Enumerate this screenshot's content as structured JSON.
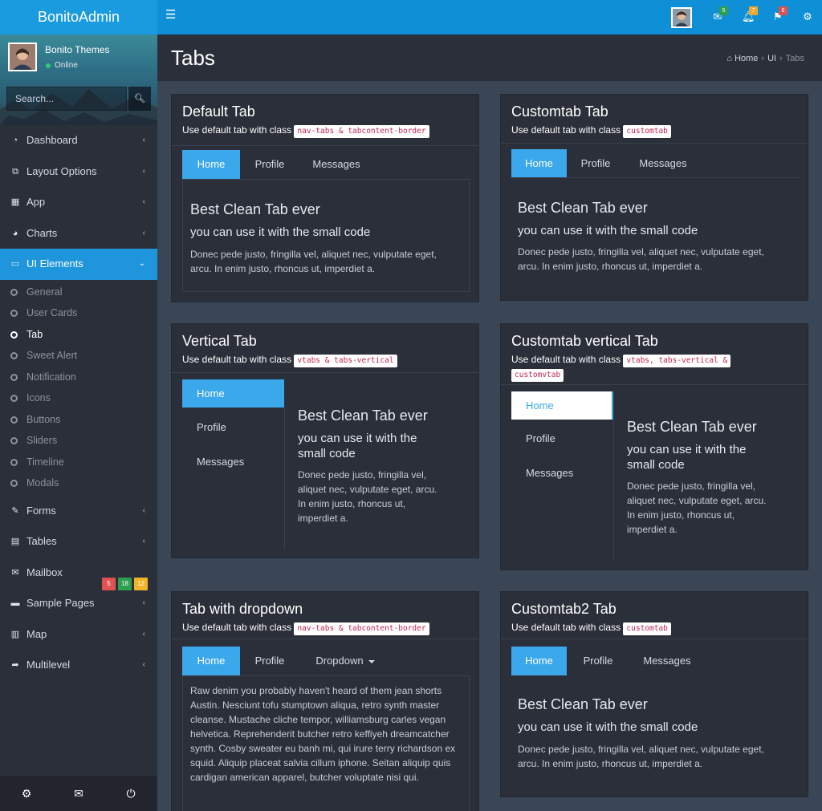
{
  "app": {
    "brand": "BonitoAdmin"
  },
  "topbar": {
    "badges": [
      {
        "icon": "envelope-icon",
        "count": "5",
        "color": "#2e9e4f"
      },
      {
        "icon": "bell-icon",
        "count": "7",
        "color": "#f0a92e"
      },
      {
        "icon": "flag-icon",
        "count": "6",
        "color": "#e05252"
      }
    ]
  },
  "user": {
    "name": "Bonito Themes",
    "status": "Online"
  },
  "search": {
    "placeholder": "Search..."
  },
  "nav": [
    {
      "label": "Dashboard",
      "icon": "dashboard-icon"
    },
    {
      "label": "Layout Options",
      "icon": "copy-icon"
    },
    {
      "label": "App",
      "icon": "grid-icon"
    },
    {
      "label": "Charts",
      "icon": "pie-chart-icon"
    },
    {
      "label": "UI Elements",
      "icon": "laptop-icon"
    },
    {
      "label": "Forms",
      "icon": "edit-icon"
    },
    {
      "label": "Tables",
      "icon": "table-icon"
    },
    {
      "label": "Mailbox",
      "icon": "envelope-icon"
    },
    {
      "label": "Sample Pages",
      "icon": "folder-icon"
    },
    {
      "label": "Map",
      "icon": "map-icon"
    },
    {
      "label": "Multilevel",
      "icon": "share-icon"
    }
  ],
  "sub_nav": [
    "General",
    "User Cards",
    "Tab",
    "Sweet Alert",
    "Notification",
    "Icons",
    "Buttons",
    "Sliders",
    "Timeline",
    "Modals"
  ],
  "mail_badges": [
    {
      "count": "5",
      "color": "#e05252"
    },
    {
      "count": "18",
      "color": "#2e9e4f"
    },
    {
      "count": "12",
      "color": "#f0b429"
    }
  ],
  "page": {
    "title": "Tabs"
  },
  "breadcrumb": [
    "Home",
    "UI",
    "Tabs"
  ],
  "boxes": {
    "default": {
      "title": "Default Tab",
      "sub": "Use default tab with class",
      "code": "nav-tabs & tabcontent-border"
    },
    "custom": {
      "title": "Customtab Tab",
      "sub": "Use default tab with class",
      "code": "customtab"
    },
    "vertical": {
      "title": "Vertical Tab",
      "sub": "Use default tab with class",
      "code": "vtabs & tabs-vertical"
    },
    "custom_vertical": {
      "title": "Customtab vertical Tab",
      "sub": "Use default tab with class",
      "code1": "vtabs, tabs-vertical &",
      "code2": "customvtab"
    },
    "dropdown": {
      "title": "Tab with dropdown",
      "sub": "Use default tab with class",
      "code": "nav-tabs & tabcontent-border"
    },
    "custom2": {
      "title": "Customtab2 Tab",
      "sub": "Use default tab with class",
      "code": "customtab"
    }
  },
  "tabs": {
    "home": "Home",
    "profile": "Profile",
    "messages": "Messages",
    "dropdown": "Dropdown"
  },
  "pane": {
    "h3": "Best Clean Tab ever",
    "h4": "you can use it with the small code",
    "p": "Donec pede justo, fringilla vel, aliquet nec, vulputate eget, arcu. In enim justo, rhoncus ut, imperdiet a.",
    "h4_line1": "you can use it with the",
    "h4_line2": "small code",
    "p_lines": [
      "Donec pede justo, fringilla vel,",
      "aliquet nec, vulputate eget, arcu.",
      "In enim justo, rhoncus ut,",
      "imperdiet a."
    ],
    "p_lines_wide": [
      "Donec pede justo, fringilla vel, aliquet nec, vulputate eget,",
      "arcu. In enim justo, rhoncus ut, imperdiet a."
    ],
    "dropdown_text": "Raw denim you probably haven't heard of them jean shorts Austin. Nesciunt tofu stumptown aliqua, retro synth master cleanse. Mustache cliche tempor, williamsburg carles vegan helvetica. Reprehenderit butcher retro keffiyeh dreamcatcher synth. Cosby sweater eu banh mi, qui irure terry richardson ex squid. Aliquip placeat salvia cillum iphone. Seitan aliquip quis cardigan american apparel, butcher voluptate nisi qui."
  },
  "footer": {
    "icons": [
      "gear-icon",
      "envelope-icon",
      "power-icon"
    ]
  }
}
